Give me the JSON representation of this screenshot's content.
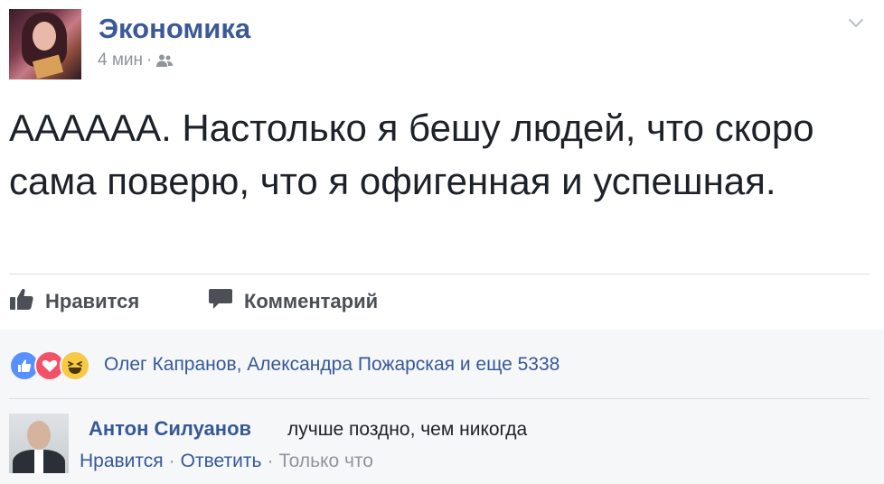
{
  "post": {
    "page_name": "Экономика",
    "time": "4 мин",
    "separator": "·",
    "audience_icon": "friends-icon",
    "menu_icon": "chevron-down-icon",
    "text": "АААААА. Настолько я бешу людей, что скоро сама поверю, что я офигенная и успешная."
  },
  "actions": {
    "like_label": "Нравится",
    "like_icon": "thumbs-up-icon",
    "comment_label": "Комментарий",
    "comment_icon": "speech-bubble-icon"
  },
  "reactions": {
    "icons": [
      "like-reaction-icon",
      "love-reaction-icon",
      "haha-reaction-icon"
    ],
    "names_text": "Олег Капранов, Александра Пожарская и еще 5338"
  },
  "comment": {
    "author": "Антон Силуанов",
    "text": "лучше поздно, чем никогда",
    "like_label": "Нравится",
    "reply_label": "Ответить",
    "time": "Только что",
    "separator": "·"
  },
  "colors": {
    "brand": "#3b5998",
    "link": "#365899",
    "text": "#1d2129",
    "muted": "#90949c",
    "like_reaction": "#5890ff",
    "love_reaction": "#f25268",
    "haha_reaction": "#f7c945"
  }
}
